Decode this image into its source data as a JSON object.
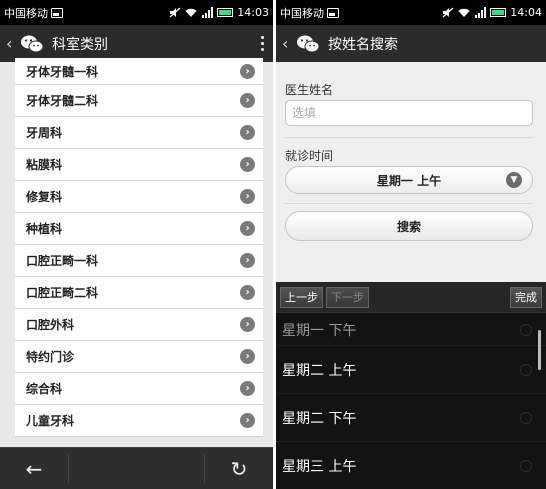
{
  "left": {
    "status": {
      "carrier": "中国移动",
      "time": "14:03"
    },
    "nav": {
      "back": "‹",
      "title": "科室类别"
    },
    "departments": [
      "牙体牙髓一科",
      "牙体牙髓二科",
      "牙周科",
      "粘膜科",
      "修复科",
      "种植科",
      "口腔正畸一科",
      "口腔正畸二科",
      "口腔外科",
      "特约门诊",
      "综合科",
      "儿童牙科"
    ],
    "toolbar": {
      "back_icon": "←",
      "refresh_icon": "↻"
    }
  },
  "right": {
    "status": {
      "carrier": "中国移动",
      "time": "14:04"
    },
    "nav": {
      "back": "‹",
      "title": "按姓名搜索"
    },
    "form": {
      "doctor_label": "医生姓名",
      "doctor_placeholder": "选填",
      "time_label": "就诊时间",
      "time_value": "星期一 上午",
      "search_label": "搜索"
    },
    "picker": {
      "prev": "上一步",
      "next": "下一步",
      "done": "完成",
      "options": [
        "星期一 下午",
        "星期二 上午",
        "星期二 下午",
        "星期三 上午"
      ]
    }
  },
  "colors": {
    "bar": "#2b2b2b",
    "status": "#000000",
    "battery": "#3ddc84"
  }
}
